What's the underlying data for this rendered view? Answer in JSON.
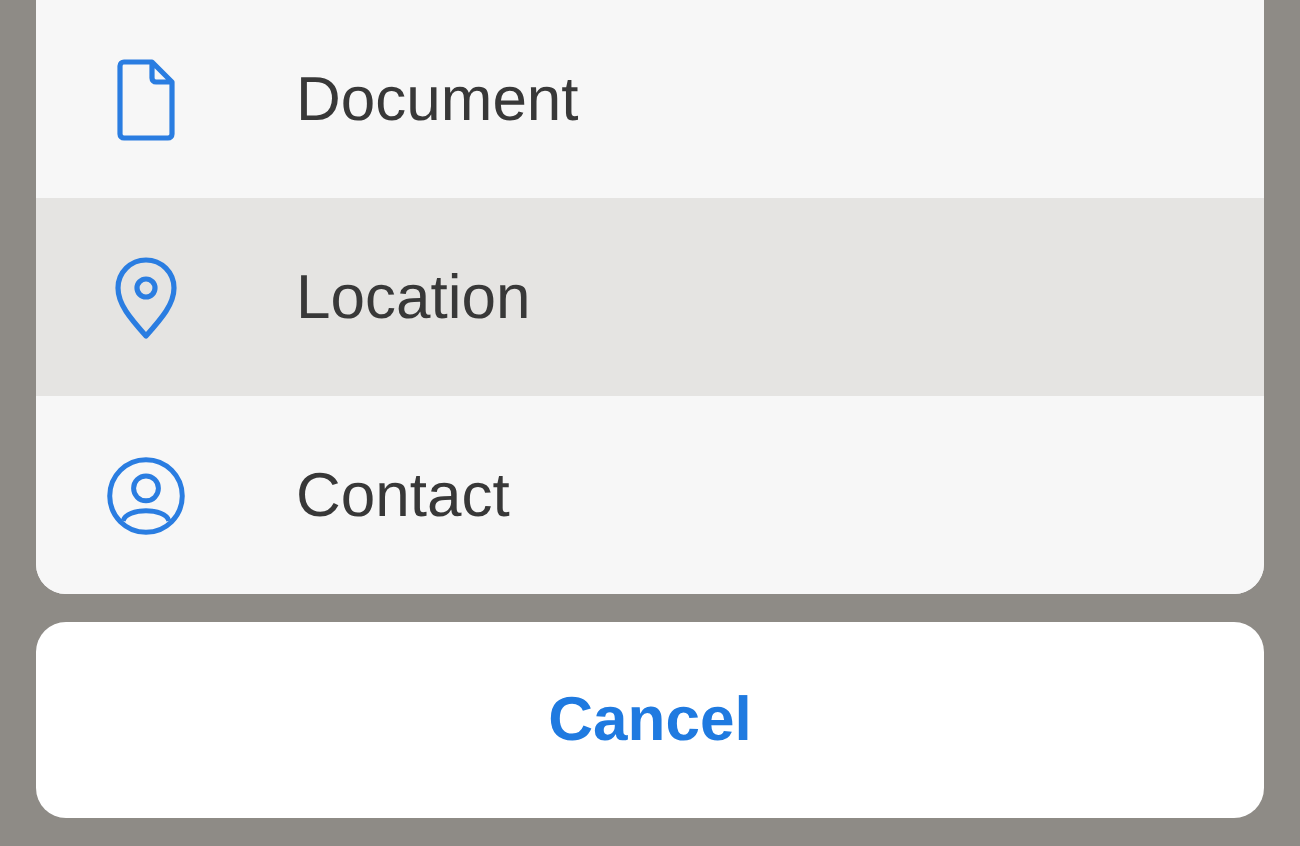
{
  "action_sheet": {
    "items": [
      {
        "label": "Document",
        "kind": "document",
        "selected": false
      },
      {
        "label": "Location",
        "kind": "location",
        "selected": true
      },
      {
        "label": "Contact",
        "kind": "contact",
        "selected": false
      }
    ]
  },
  "cancel_button": {
    "label": "Cancel"
  }
}
